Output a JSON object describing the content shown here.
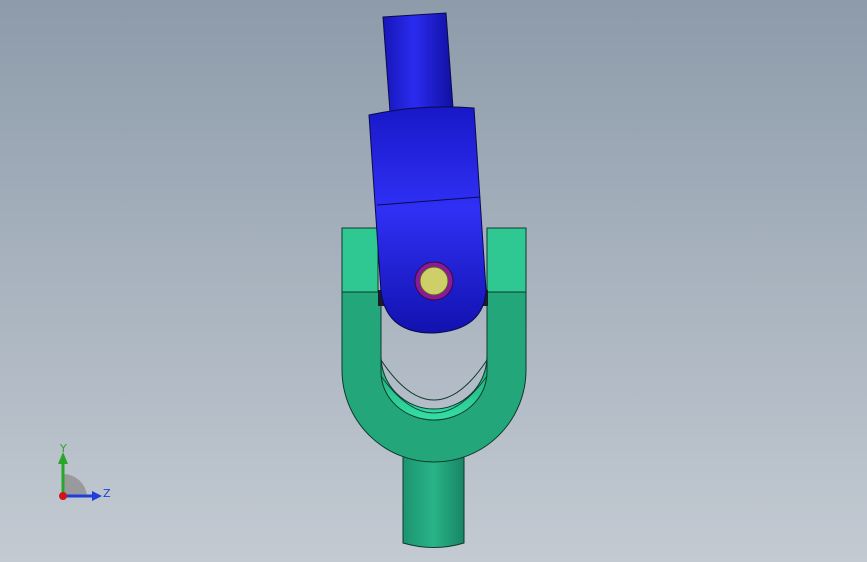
{
  "triad": {
    "y_label": "Y",
    "z_label": "Z",
    "y_color": "#2aa52a",
    "z_color": "#1f3fd6",
    "x_color": "#d01515"
  },
  "colors": {
    "background_top": "#8d9baa",
    "background_bottom": "#c3cad2",
    "blue_yoke": "#1a1ad6",
    "green_yoke": "#22a67a",
    "pin": "#cfcf6a",
    "pin_ring": "#8a1a9a"
  }
}
